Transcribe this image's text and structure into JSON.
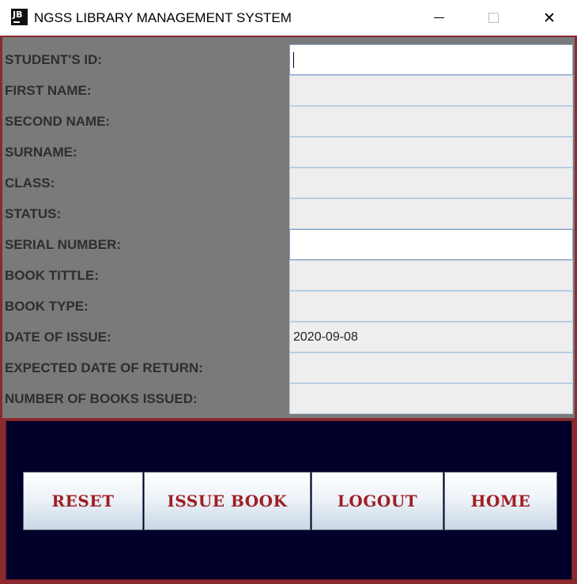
{
  "window": {
    "title": "NGSS LIBRARY MANAGEMENT SYSTEM",
    "icon_text": "JB",
    "close_glyph": "✕"
  },
  "form": {
    "fields": [
      {
        "label": "STUDENT'S ID:",
        "value": ""
      },
      {
        "label": "FIRST NAME:",
        "value": ""
      },
      {
        "label": "SECOND NAME:",
        "value": ""
      },
      {
        "label": "SURNAME:",
        "value": ""
      },
      {
        "label": "CLASS:",
        "value": ""
      },
      {
        "label": "STATUS:",
        "value": ""
      },
      {
        "label": "SERIAL NUMBER:",
        "value": ""
      },
      {
        "label": "BOOK TITTLE:",
        "value": ""
      },
      {
        "label": "BOOK TYPE:",
        "value": ""
      },
      {
        "label": "DATE OF ISSUE:",
        "value": "2020-09-08"
      },
      {
        "label": "EXPECTED DATE OF RETURN:",
        "value": ""
      },
      {
        "label": "NUMBER OF BOOKS ISSUED:",
        "value": ""
      }
    ]
  },
  "buttons": {
    "reset": "RESET",
    "issue_book": "ISSUE BOOK",
    "logout": "LOGOUT",
    "home": "HOME"
  },
  "colors": {
    "form_background": "#7a7a7a",
    "button_panel_background": "#00002a",
    "button_text": "#a01e24",
    "frame_border": "#8b2a2f"
  }
}
